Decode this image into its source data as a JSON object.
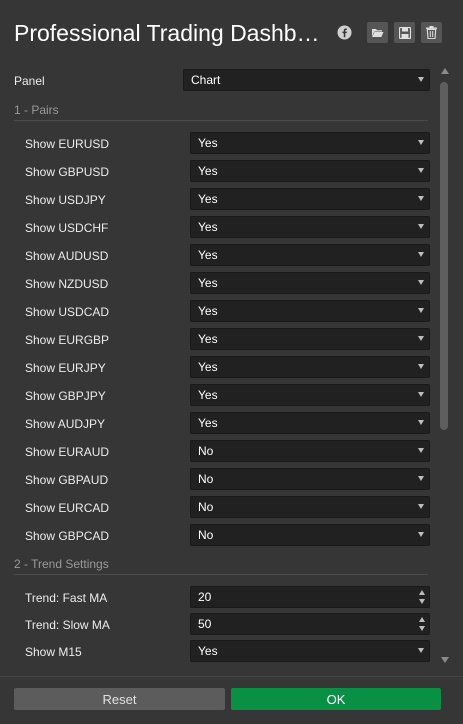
{
  "header": {
    "title": "Professional Trading Dashb…",
    "icons": [
      "facebook-icon",
      "folder-open-icon",
      "save-icon",
      "trash-icon"
    ]
  },
  "panel": {
    "label": "Panel",
    "value": "Chart"
  },
  "sections": {
    "pairs": "1 - Pairs",
    "trend": "2 - Trend Settings"
  },
  "pairs": [
    {
      "label": "Show EURUSD",
      "value": "Yes"
    },
    {
      "label": "Show GBPUSD",
      "value": "Yes"
    },
    {
      "label": "Show USDJPY",
      "value": "Yes"
    },
    {
      "label": "Show USDCHF",
      "value": "Yes"
    },
    {
      "label": "Show AUDUSD",
      "value": "Yes"
    },
    {
      "label": "Show NZDUSD",
      "value": "Yes"
    },
    {
      "label": "Show USDCAD",
      "value": "Yes"
    },
    {
      "label": "Show EURGBP",
      "value": "Yes"
    },
    {
      "label": "Show EURJPY",
      "value": "Yes"
    },
    {
      "label": "Show GBPJPY",
      "value": "Yes"
    },
    {
      "label": "Show AUDJPY",
      "value": "Yes"
    },
    {
      "label": "Show EURAUD",
      "value": "No"
    },
    {
      "label": "Show GBPAUD",
      "value": "No"
    },
    {
      "label": "Show EURCAD",
      "value": "No"
    },
    {
      "label": "Show GBPCAD",
      "value": "No"
    }
  ],
  "trend": {
    "fast_ma": {
      "label": "Trend: Fast MA",
      "value": "20"
    },
    "slow_ma": {
      "label": "Trend: Slow MA",
      "value": "50"
    },
    "m15": {
      "label": "Show M15",
      "value": "Yes"
    }
  },
  "footer": {
    "reset_label": "Reset",
    "ok_label": "OK"
  },
  "colors": {
    "background": "#363636",
    "field": "#212121",
    "ok": "#0a9045",
    "reset": "#5c5c5c"
  }
}
